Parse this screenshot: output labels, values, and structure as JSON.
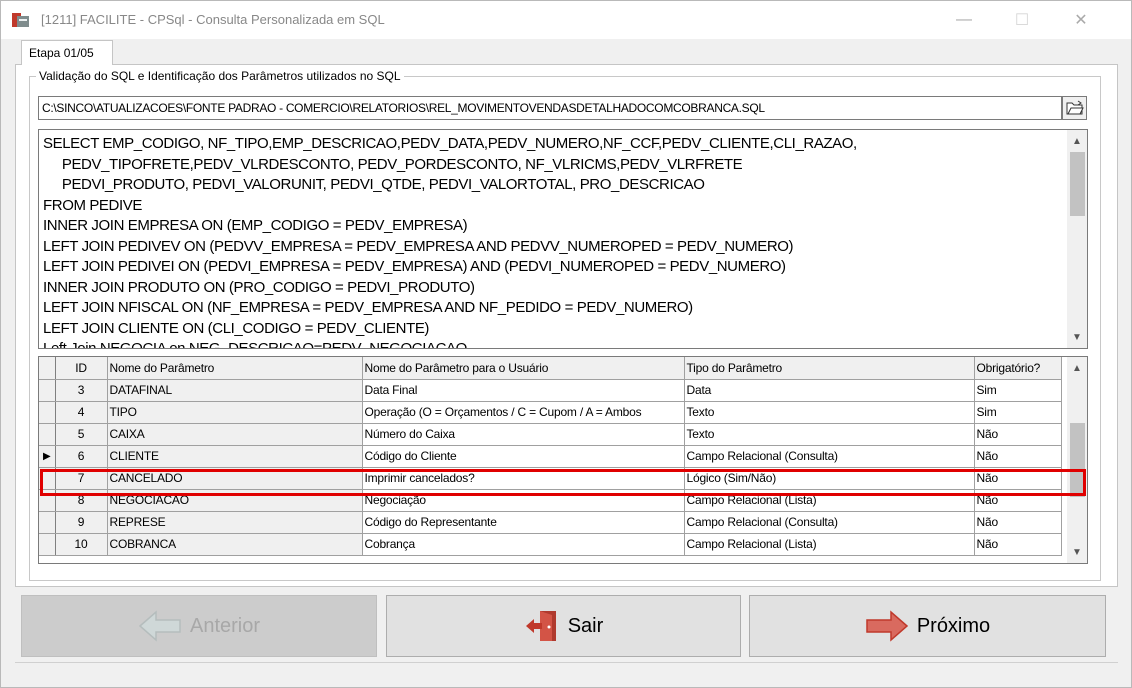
{
  "window": {
    "title": "[1211] FACILITE - CPSql - Consulta Personalizada em SQL",
    "minimize_glyph": "—",
    "maximize_glyph": "☐",
    "close_glyph": "✕"
  },
  "tab": {
    "label": "Etapa 01/05"
  },
  "group": {
    "label": "Validação do SQL e Identificação dos Parâmetros utilizados no SQL"
  },
  "path_field": {
    "value": "C:\\SINCO\\ATUALIZACOES\\FONTE PADRAO - COMERCIO\\RELATORIOS\\REL_MOVIMENTOVENDASDETALHADOCOMCOBRANCA.SQL"
  },
  "sql": {
    "text": "SELECT EMP_CODIGO, NF_TIPO,EMP_DESCRICAO,PEDV_DATA,PEDV_NUMERO,NF_CCF,PEDV_CLIENTE,CLI_RAZAO,\n     PEDV_TIPOFRETE,PEDV_VLRDESCONTO, PEDV_PORDESCONTO, NF_VLRICMS,PEDV_VLRFRETE\n     PEDVI_PRODUTO, PEDVI_VALORUNIT, PEDVI_QTDE, PEDVI_VALORTOTAL, PRO_DESCRICAO\nFROM PEDIVE\nINNER JOIN EMPRESA ON (EMP_CODIGO = PEDV_EMPRESA)\nLEFT JOIN PEDIVEV ON (PEDVV_EMPRESA = PEDV_EMPRESA AND PEDVV_NUMEROPED = PEDV_NUMERO)\nLEFT JOIN PEDIVEI ON (PEDVI_EMPRESA = PEDV_EMPRESA) AND (PEDVI_NUMEROPED = PEDV_NUMERO)\nINNER JOIN PRODUTO ON (PRO_CODIGO = PEDVI_PRODUTO)\nLEFT JOIN NFISCAL ON (NF_EMPRESA = PEDV_EMPRESA AND NF_PEDIDO = PEDV_NUMERO)\nLEFT JOIN CLIENTE ON (CLI_CODIGO = PEDV_CLIENTE)\nLeft Join NEGOCIA on NEG_DESCRICAO=PEDV_NEGOCIACAO"
  },
  "grid": {
    "headers": {
      "id": "ID",
      "nome": "Nome do Parâmetro",
      "nome_usuario": "Nome do Parâmetro para o Usuário",
      "tipo": "Tipo do Parâmetro",
      "obrigatorio": "Obrigatório?"
    },
    "rows": [
      {
        "id": "3",
        "nome": "DATAFINAL",
        "nome_usuario": "Data Final",
        "tipo": "Data",
        "obrigatorio": "Sim",
        "indicator": ""
      },
      {
        "id": "4",
        "nome": "TIPO",
        "nome_usuario": "Operação (O = Orçamentos / C = Cupom / A = Ambos",
        "tipo": "Texto",
        "obrigatorio": "Sim",
        "indicator": ""
      },
      {
        "id": "5",
        "nome": "CAIXA",
        "nome_usuario": "Número do Caixa",
        "tipo": "Texto",
        "obrigatorio": "Não",
        "indicator": ""
      },
      {
        "id": "6",
        "nome": "CLIENTE",
        "nome_usuario": "Código do Cliente",
        "tipo": "Campo Relacional (Consulta)",
        "obrigatorio": "Não",
        "indicator": "▶"
      },
      {
        "id": "7",
        "nome": "CANCELADO",
        "nome_usuario": "Imprimir cancelados?",
        "tipo": "Lógico (Sim/Não)",
        "obrigatorio": "Não",
        "indicator": ""
      },
      {
        "id": "8",
        "nome": "NEGOCIACAO",
        "nome_usuario": "Negociação",
        "tipo": "Campo Relacional (Lista)",
        "obrigatorio": "Não",
        "indicator": ""
      },
      {
        "id": "9",
        "nome": "REPRESE",
        "nome_usuario": "Código do Representante",
        "tipo": "Campo Relacional (Consulta)",
        "obrigatorio": "Não",
        "indicator": ""
      },
      {
        "id": "10",
        "nome": "COBRANCA",
        "nome_usuario": "Cobrança",
        "tipo": "Campo Relacional (Lista)",
        "obrigatorio": "Não",
        "indicator": ""
      }
    ]
  },
  "buttons": {
    "prev": "Anterior",
    "exit": "Sair",
    "next": "Próximo"
  },
  "colors": {
    "highlight": "#e00000",
    "arrow_red": "#d9534f",
    "disabled_text": "#a8a8a8"
  }
}
